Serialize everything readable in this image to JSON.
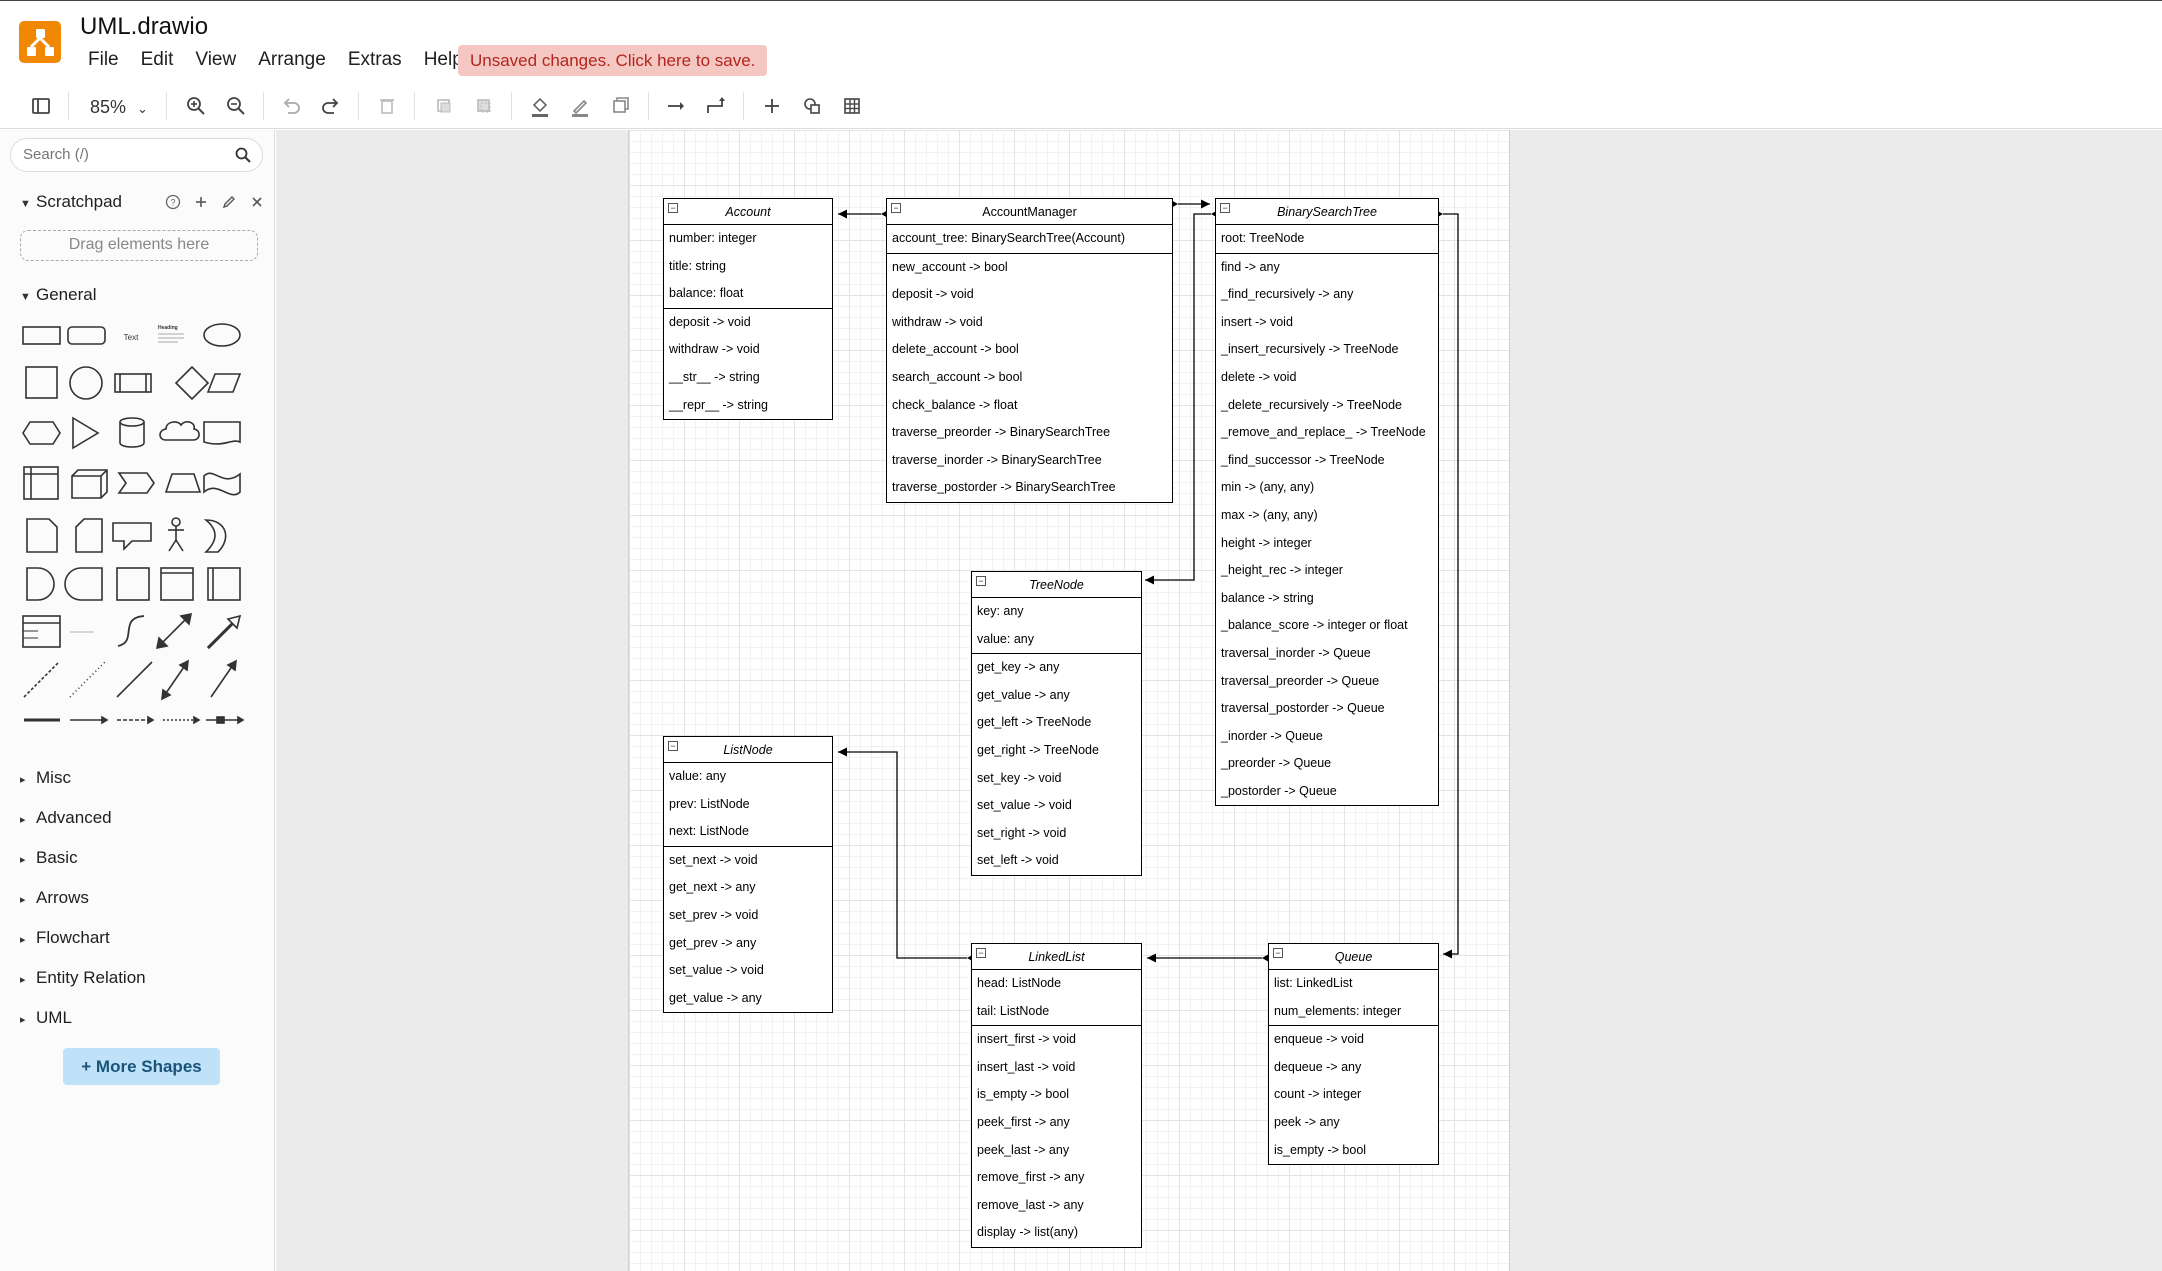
{
  "app": {
    "title": "UML.drawio"
  },
  "menu": [
    "File",
    "Edit",
    "View",
    "Arrange",
    "Extras",
    "Help"
  ],
  "unsaved_notice": "Unsaved changes. Click here to save.",
  "toolbar": {
    "zoom": "85%"
  },
  "sidebar": {
    "search_placeholder": "Search (/)",
    "scratchpad_label": "Scratchpad",
    "dropzone_label": "Drag elements here",
    "general_label": "General",
    "shape_text_label": "Text",
    "shape_heading_label": "Heading",
    "collapsed_sections": [
      "Misc",
      "Advanced",
      "Basic",
      "Arrows",
      "Flowchart",
      "Entity Relation",
      "UML"
    ],
    "more_shapes": "+ More Shapes"
  },
  "classes": [
    {
      "name": "Account",
      "italic": true,
      "attributes": [
        "number: integer",
        "title: string",
        "balance: float"
      ],
      "methods": [
        "deposit -> void",
        "withdraw -> void",
        "__str__ -> string",
        "__repr__ -> string"
      ]
    },
    {
      "name": "AccountManager",
      "italic": false,
      "attributes": [
        "account_tree: BinarySearchTree(Account)"
      ],
      "methods": [
        "new_account -> bool",
        "deposit -> void",
        "withdraw -> void",
        "delete_account -> bool",
        "search_account -> bool",
        "check_balance -> float",
        "traverse_preorder -> BinarySearchTree",
        "traverse_inorder -> BinarySearchTree",
        "traverse_postorder -> BinarySearchTree"
      ]
    },
    {
      "name": "BinarySearchTree",
      "italic": true,
      "attributes": [
        "root: TreeNode"
      ],
      "methods": [
        "find -> any",
        "_find_recursively -> any",
        "insert -> void",
        "_insert_recursively -> TreeNode",
        "delete -> void",
        "_delete_recursively -> TreeNode",
        "_remove_and_replace_ -> TreeNode",
        "_find_successor -> TreeNode",
        "min -> (any, any)",
        "max -> (any, any)",
        "height -> integer",
        "_height_rec -> integer",
        "balance -> string",
        "_balance_score -> integer or float",
        "traversal_inorder -> Queue",
        "traversal_preorder -> Queue",
        "traversal_postorder -> Queue",
        "_inorder -> Queue",
        "_preorder -> Queue",
        "_postorder -> Queue"
      ]
    },
    {
      "name": "TreeNode",
      "italic": true,
      "attributes": [
        "key: any",
        "value: any"
      ],
      "methods": [
        "get_key -> any",
        "get_value -> any",
        "get_left -> TreeNode",
        "get_right -> TreeNode",
        "set_key -> void",
        "set_value -> void",
        "set_right -> void",
        "set_left -> void"
      ]
    },
    {
      "name": "ListNode",
      "italic": true,
      "attributes": [
        "value: any",
        "prev: ListNode",
        "next: ListNode"
      ],
      "methods": [
        "set_next -> void",
        "get_next -> any",
        "set_prev -> void",
        "get_prev -> any",
        "set_value -> void",
        "get_value -> any"
      ]
    },
    {
      "name": "LinkedList",
      "italic": true,
      "attributes": [
        "head: ListNode",
        "tail: ListNode"
      ],
      "methods": [
        "insert_first -> void",
        "insert_last -> void",
        "is_empty -> bool",
        "peek_first -> any",
        "peek_last -> any",
        "remove_first -> any",
        "remove_last -> any",
        "display -> list(any)"
      ]
    },
    {
      "name": "Queue",
      "italic": true,
      "attributes": [
        "list: LinkedList",
        "num_elements: integer"
      ],
      "methods": [
        "enqueue -> void",
        "dequeue -> any",
        "count -> integer",
        "peek -> any",
        "is_empty -> bool"
      ]
    }
  ],
  "relationships": [
    {
      "from": "AccountManager",
      "to": "Account",
      "type": "composition"
    },
    {
      "from": "AccountManager",
      "to": "BinarySearchTree",
      "type": "composition"
    },
    {
      "from": "BinarySearchTree",
      "to": "TreeNode",
      "type": "composition"
    },
    {
      "from": "BinarySearchTree",
      "to": "Queue",
      "type": "composition"
    },
    {
      "from": "LinkedList",
      "to": "ListNode",
      "type": "composition"
    },
    {
      "from": "Queue",
      "to": "LinkedList",
      "type": "composition"
    }
  ]
}
